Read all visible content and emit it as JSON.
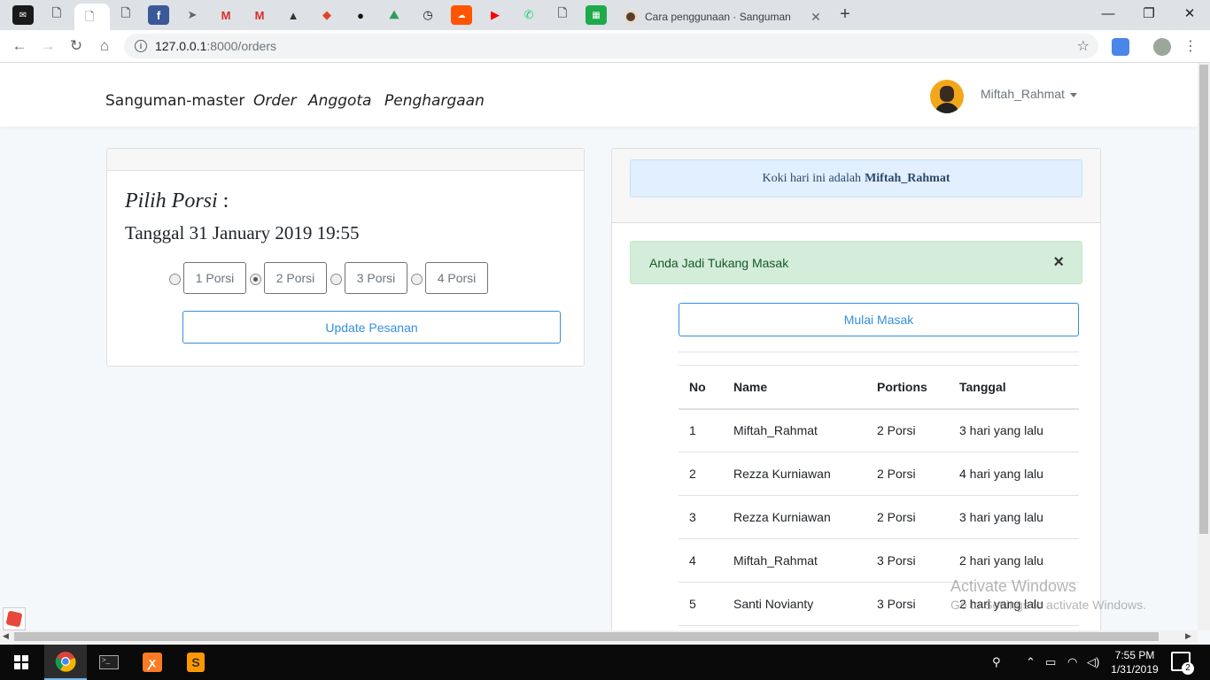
{
  "browser": {
    "tabs": {
      "active_title": "Cara penggunaan · Sanguman",
      "new_tab": "+"
    },
    "window_controls": {
      "minimize": "—",
      "maximize": "❐",
      "close": "✕"
    },
    "address": {
      "host": "127.0.0.1",
      "path": ":8000/orders"
    }
  },
  "navbar": {
    "brand": "Sanguman-master",
    "links": [
      "Order",
      "Anggota",
      "Penghargaan"
    ],
    "user": "Miftah_Rahmat"
  },
  "order_card": {
    "heading": "Pilih Porsi",
    "heading_suffix": " :",
    "date_line": "Tanggal 31 January 2019 19:55",
    "portions": [
      "1 Porsi",
      "2 Porsi",
      "3 Porsi",
      "4 Porsi"
    ],
    "selected_portion": "2 Porsi",
    "update_button": "Update Pesanan"
  },
  "cook_card": {
    "cook_prefix": "Koki hari ini adalah",
    "cook_name": "Miftah_Rahmat",
    "alert": "Anda Jadi Tukang Masak",
    "alert_close": "×",
    "start_button": "Mulai Masak",
    "table": {
      "headers": [
        "No",
        "Name",
        "Portions",
        "Tanggal"
      ],
      "rows": [
        [
          "1",
          "Miftah_Rahmat",
          "2 Porsi",
          "3 hari yang lalu"
        ],
        [
          "2",
          "Rezza Kurniawan",
          "2 Porsi",
          "4 hari yang lalu"
        ],
        [
          "3",
          "Rezza Kurniawan",
          "2 Porsi",
          "3 hari yang lalu"
        ],
        [
          "4",
          "Miftah_Rahmat",
          "3 Porsi",
          "2 hari yang lalu"
        ],
        [
          "5",
          "Santi Novianty",
          "3 Porsi",
          "2 hari yang lalu"
        ]
      ]
    }
  },
  "watermark": {
    "title": "Activate Windows",
    "subtitle": "Go to Settings to activate Windows."
  },
  "taskbar": {
    "time": "7:55 PM",
    "date": "1/31/2019",
    "notifications": "2"
  },
  "colors": {
    "primary": "#3490dc",
    "success_bg": "#d4edda",
    "info_bg": "#e1efff"
  }
}
